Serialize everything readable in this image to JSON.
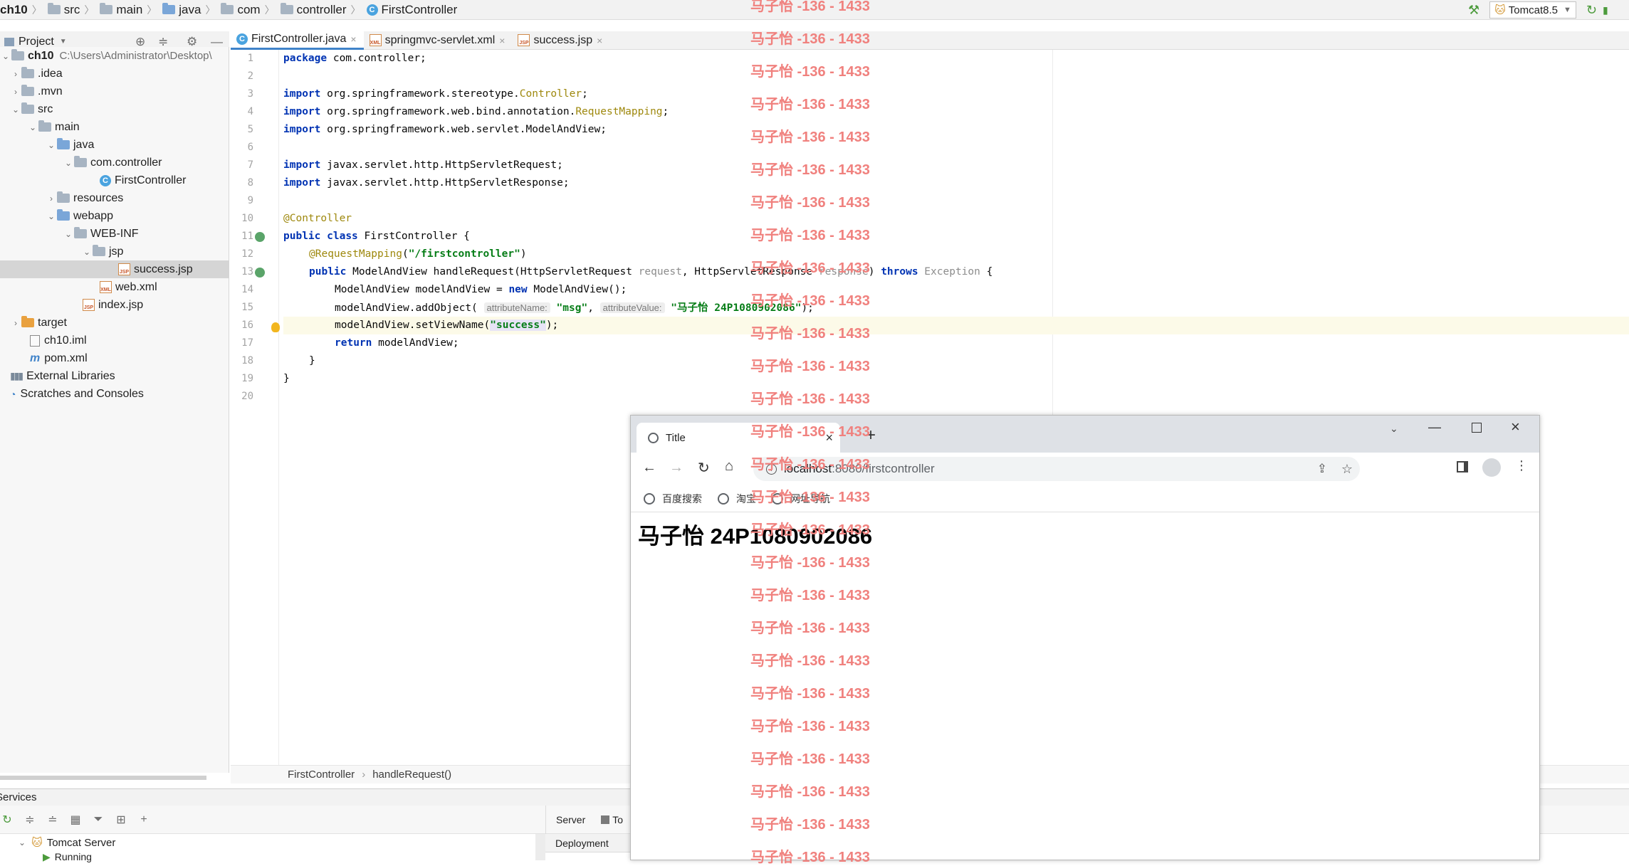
{
  "navbar": {
    "crumbs": [
      "ch10",
      "src",
      "main",
      "java",
      "com",
      "controller",
      "FirstController"
    ],
    "run_config": "Tomcat8.5"
  },
  "project_panel": {
    "title": "Project",
    "tree": [
      {
        "label": "ch10",
        "path": "C:\\Users\\Administrator\\Desktop\\"
      },
      {
        "label": ".idea"
      },
      {
        "label": ".mvn"
      },
      {
        "label": "src"
      },
      {
        "label": "main"
      },
      {
        "label": "java"
      },
      {
        "label": "com.controller"
      },
      {
        "label": "FirstController"
      },
      {
        "label": "resources"
      },
      {
        "label": "webapp"
      },
      {
        "label": "WEB-INF"
      },
      {
        "label": "jsp"
      },
      {
        "label": "success.jsp"
      },
      {
        "label": "web.xml"
      },
      {
        "label": "index.jsp"
      },
      {
        "label": "target"
      },
      {
        "label": "ch10.iml"
      },
      {
        "label": "pom.xml"
      },
      {
        "label": "External Libraries"
      },
      {
        "label": "Scratches and Consoles"
      }
    ]
  },
  "editor": {
    "tabs": [
      {
        "label": "FirstController.java"
      },
      {
        "label": "springmvc-servlet.xml"
      },
      {
        "label": "success.jsp"
      }
    ],
    "line_numbers": [
      "1",
      "2",
      "3",
      "4",
      "5",
      "6",
      "7",
      "8",
      "9",
      "10",
      "11",
      "12",
      "13",
      "14",
      "15",
      "16",
      "17",
      "18",
      "19",
      "20"
    ],
    "code": {
      "l1_kw": "package",
      "l1_rest": " com.controller;",
      "import_kw": "import",
      "l3_rest": " org.springframework.stereotype.",
      "l3_ann": "Controller",
      "semi": ";",
      "l4_rest": " org.springframework.web.bind.annotation.",
      "l4_ann": "RequestMapping",
      "l5_rest": " org.springframework.web.servlet.ModelAndView;",
      "l7_rest": " javax.servlet.http.HttpServletRequest;",
      "l8_rest": " javax.servlet.http.HttpServletResponse;",
      "l10_ann": "@Controller",
      "l11_kw1": "public",
      "l11_kw2": "class",
      "l11_rest": " FirstController {",
      "l12_ann": "@RequestMapping",
      "l12_open": "(",
      "l12_str": "\"/firstcontroller\"",
      "l12_close": ")",
      "l13_kw1": "public",
      "l13_a": " ModelAndView handleRequest(HttpServletRequest ",
      "l13_p1": "request",
      "l13_b": ", HttpServletResponse ",
      "l13_p2": "response",
      "l13_c": ") ",
      "l13_kw2": "throws",
      "l13_exc": " Exception",
      "l13_d": " {",
      "l14_a": "ModelAndView modelAndView = ",
      "l14_kw": "new",
      "l14_b": " ModelAndView();",
      "l15_a": "modelAndView.addObject(",
      "l15_h1": "attributeName:",
      "l15_s1": "\"msg\"",
      "l15_comma": ", ",
      "l15_h2": "attributeValue:",
      "l15_s2": "\"马子怡 24P1080902086\"",
      "l15_end": ");",
      "l16_a": "modelAndView.setViewName(",
      "l16_s": "\"success\"",
      "l16_end": ");",
      "l17_kw": "return",
      "l17_rest": " modelAndView;",
      "l18": "}",
      "l19": "}"
    },
    "breadcrumb": [
      "FirstController",
      "handleRequest()"
    ]
  },
  "services": {
    "title": "Services",
    "tree_item": "Tomcat Server",
    "child_item": "Running",
    "tabs": [
      "Server",
      "To"
    ],
    "deployment_label": "Deployment"
  },
  "browser": {
    "tab_title": "Title",
    "url_host": "localhost",
    "url_rest": ":8080/firstcontroller",
    "bookmarks": [
      "百度搜索",
      "淘宝",
      "网址导航"
    ],
    "page_heading": "马子怡 24P1080902086"
  },
  "watermark": {
    "text": "马子怡 -136 - 1433",
    "repeat_count": 27,
    "color": "#f0817e"
  },
  "colors": {
    "keyword": "#0033b3",
    "annotation": "#9e880d",
    "string": "#067d17",
    "accent": "#4083c9"
  }
}
